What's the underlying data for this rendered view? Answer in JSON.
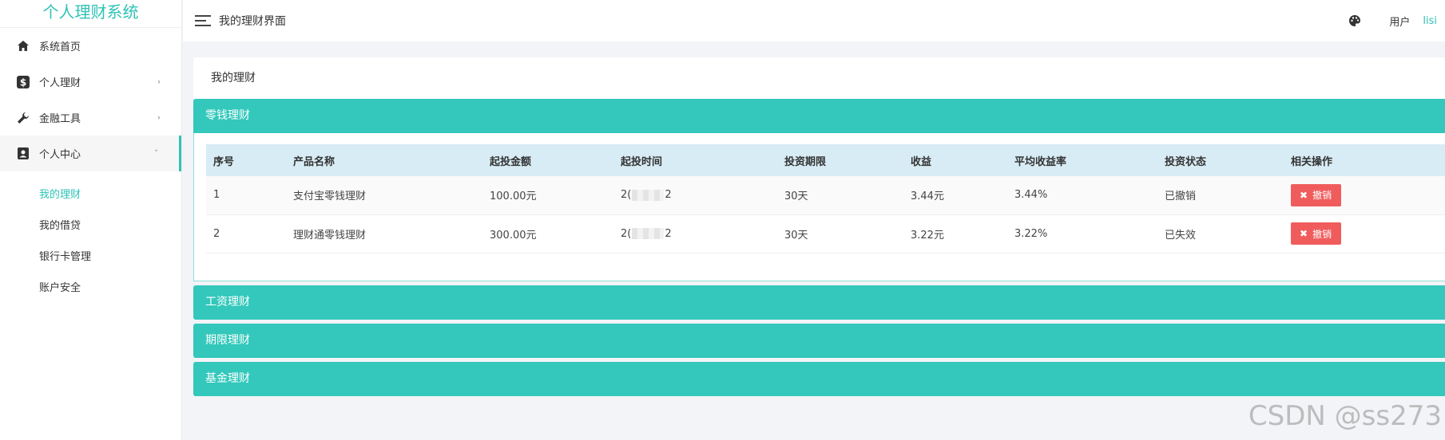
{
  "app": {
    "title": "个人理财系统"
  },
  "sidebar": {
    "items": [
      {
        "label": "系统首页",
        "icon": "home-icon"
      },
      {
        "label": "个人理财",
        "icon": "dollar-icon",
        "arrow": "›"
      },
      {
        "label": "金融工具",
        "icon": "wrench-icon",
        "arrow": "›"
      },
      {
        "label": "个人中心",
        "icon": "user-card-icon",
        "arrow": "˅"
      }
    ],
    "subitems": [
      {
        "label": "我的理财",
        "active": true
      },
      {
        "label": "我的借贷"
      },
      {
        "label": "银行卡管理"
      },
      {
        "label": "账户安全"
      }
    ]
  },
  "header": {
    "title": "我的理财界面",
    "user_label": "用户",
    "username": "lisi"
  },
  "page": {
    "title": "我的理财"
  },
  "panels": [
    {
      "title": "零钱理财",
      "open": true
    },
    {
      "title": "工资理财"
    },
    {
      "title": "期限理财"
    },
    {
      "title": "基金理财"
    }
  ],
  "table": {
    "columns": [
      "序号",
      "产品名称",
      "起投金额",
      "起投时间",
      "投资期限",
      "收益",
      "平均收益率",
      "投资状态",
      "相关操作"
    ],
    "rows": [
      {
        "no": "1",
        "name": "支付宝零钱理财",
        "amount": "100.00元",
        "date_start": "2(",
        "date_end": "2",
        "term": "30天",
        "income": "3.44元",
        "rate": "3.44%",
        "status": "已撤销",
        "action": "撤销"
      },
      {
        "no": "2",
        "name": "理财通零钱理财",
        "amount": "300.00元",
        "date_start": "2(",
        "date_end": "2",
        "term": "30天",
        "income": "3.22元",
        "rate": "3.22%",
        "status": "已失效",
        "action": "撤销"
      }
    ]
  },
  "watermark": "CSDN @ss273",
  "colors": {
    "accent": "#33c8bb",
    "danger": "#f05c5c",
    "table_head": "#d8ecf5"
  }
}
